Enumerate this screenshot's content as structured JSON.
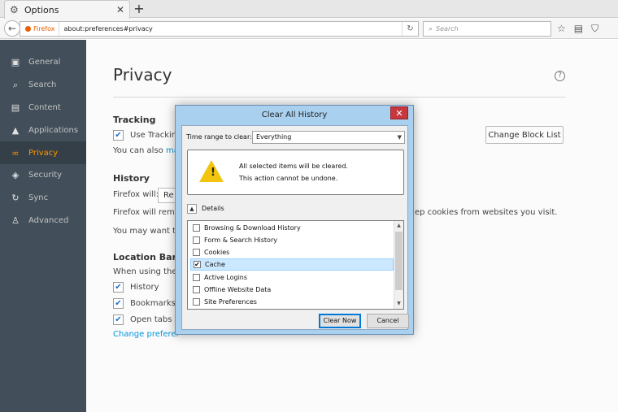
{
  "browser": {
    "tab_title": "Options",
    "tab_icon": "gear-icon",
    "new_tab_glyph": "+",
    "identity_label": "Firefox",
    "url": "about:preferences#privacy",
    "search_placeholder": "Search"
  },
  "sidebar": {
    "items": [
      {
        "label": "General",
        "icon": "general-icon"
      },
      {
        "label": "Search",
        "icon": "search-icon"
      },
      {
        "label": "Content",
        "icon": "content-icon"
      },
      {
        "label": "Applications",
        "icon": "applications-icon"
      },
      {
        "label": "Privacy",
        "icon": "mask-icon",
        "active": true
      },
      {
        "label": "Security",
        "icon": "shield-icon"
      },
      {
        "label": "Sync",
        "icon": "sync-icon"
      },
      {
        "label": "Advanced",
        "icon": "wizard-icon"
      }
    ]
  },
  "privacy": {
    "title": "Privacy",
    "tracking_heading": "Tracking",
    "tracking_checkbox_label": "Use Tracking",
    "tracking_text": "You can also",
    "tracking_link": "ma",
    "change_block_list": "Change Block List",
    "history_heading": "History",
    "firefox_will_label": "Firefox will:",
    "firefox_will_value": "Re",
    "history_text1": "Firefox will reme",
    "history_text1_tail": "ep cookies from websites you visit.",
    "history_text2": "You may want to",
    "location_heading": "Location Bar",
    "location_text": "When using the l",
    "loc_history": "History",
    "loc_bookmarks": "Bookmarks",
    "loc_open_tabs": "Open tabs",
    "change_prefs_link": "Change preferer"
  },
  "dialog": {
    "title": "Clear All History",
    "time_range_label": "Time range to clear:",
    "time_range_value": "Everything",
    "warning_line1": "All selected items will be cleared.",
    "warning_line2": "This action cannot be undone.",
    "details_label": "Details",
    "items": [
      {
        "label": "Browsing & Download History",
        "checked": false
      },
      {
        "label": "Form & Search History",
        "checked": false
      },
      {
        "label": "Cookies",
        "checked": false
      },
      {
        "label": "Cache",
        "checked": true,
        "selected": true
      },
      {
        "label": "Active Logins",
        "checked": false
      },
      {
        "label": "Offline Website Data",
        "checked": false
      },
      {
        "label": "Site Preferences",
        "checked": false
      }
    ],
    "clear_now": "Clear Now",
    "cancel": "Cancel"
  }
}
